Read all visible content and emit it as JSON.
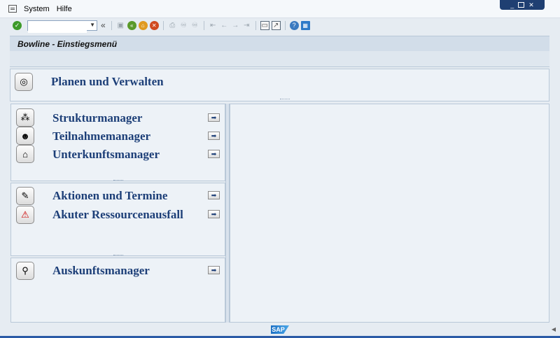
{
  "menubar": {
    "items": [
      "System",
      "Hilfe"
    ]
  },
  "toolbar": {
    "command_value": "",
    "icons": [
      "ok-icon",
      "back-icon",
      "exit-icon",
      "cancel-icon",
      "save-icon",
      "print-icon",
      "find-icon",
      "find-next-icon",
      "first-page-icon",
      "prev-page-icon",
      "next-page-icon",
      "last-page-icon",
      "new-session-icon",
      "shortcut-icon",
      "help-icon",
      "customize-layout-icon"
    ]
  },
  "window": {
    "controls": [
      "minimize",
      "maximize",
      "close"
    ]
  },
  "title": "Bowline - Einstiegsmenü",
  "top_item": {
    "label": "Planen und Verwalten",
    "icon": "planning-icon"
  },
  "group1": [
    {
      "label": "Strukturmanager",
      "icon": "structure-icon"
    },
    {
      "label": "Teilnahmemanager",
      "icon": "participants-icon"
    },
    {
      "label": "Unterkunftsmanager",
      "icon": "accommodation-icon"
    }
  ],
  "group2": [
    {
      "label": "Aktionen und Termine",
      "icon": "actions-icon"
    },
    {
      "label": "Akuter Ressourcenausfall",
      "icon": "warning-icon"
    }
  ],
  "group3": [
    {
      "label": "Auskunftsmanager",
      "icon": "info-search-icon"
    }
  ],
  "status": {
    "logo": "SAP"
  },
  "colors": {
    "label": "#1d3f78",
    "background": "#e6ecf2",
    "titlebar": "#d2dde9"
  }
}
